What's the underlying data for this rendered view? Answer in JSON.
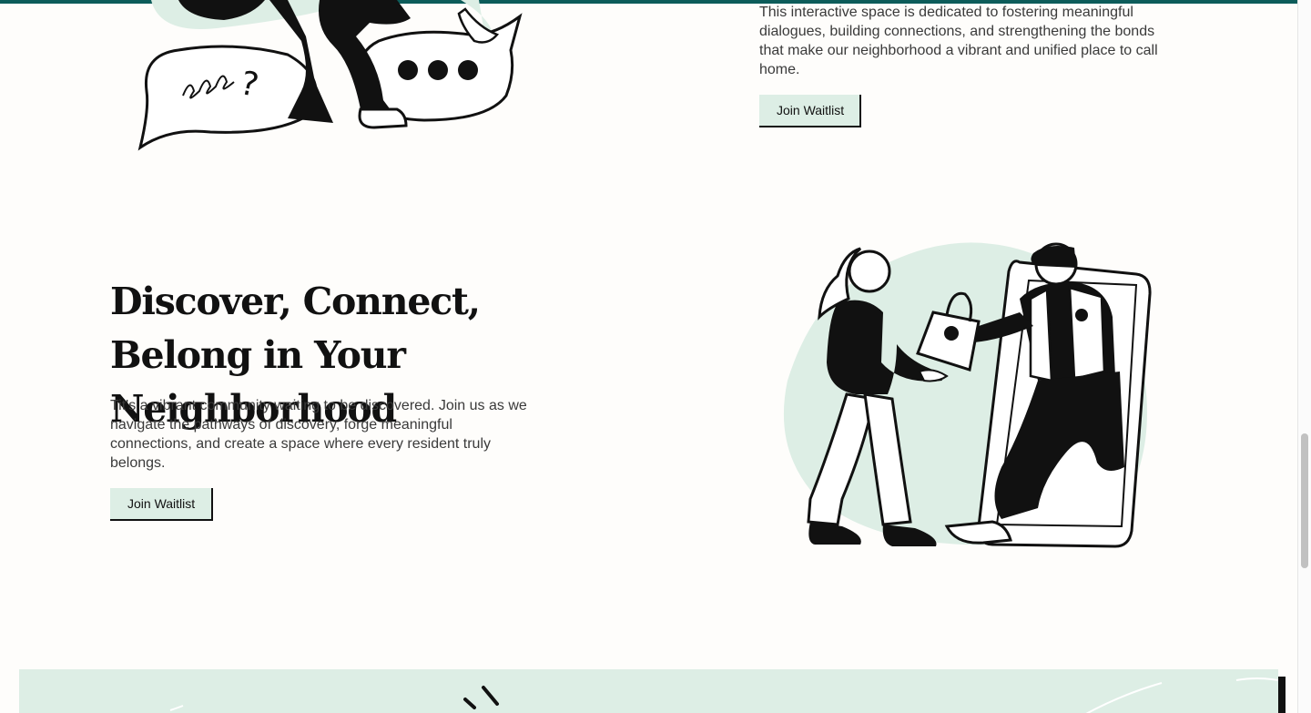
{
  "intro": {
    "text": "This interactive space is dedicated to fostering meaningful dialogues, building connections, and strengthening the bonds that make our neighborhood a vibrant and unified place to call home.",
    "button_label": "Join Waitlist"
  },
  "discover": {
    "heading": "Discover, Connect, Belong in Your Neighborhood",
    "text": "Tit's a vibrant community waiting to be discovered. Join us as we navigate the pathways of discovery, forge meaningful connections, and create a space where every resident truly belongs.",
    "button_label": "Join Waitlist"
  },
  "colors": {
    "accent": "#0d5c5a",
    "mint": "#ddeee5",
    "ink": "#111111",
    "page": "#fefdfb"
  },
  "icons": {
    "illustration_top": "speech-bubbles-people-illustration",
    "illustration_mid": "delivery-handoff-illustration"
  }
}
